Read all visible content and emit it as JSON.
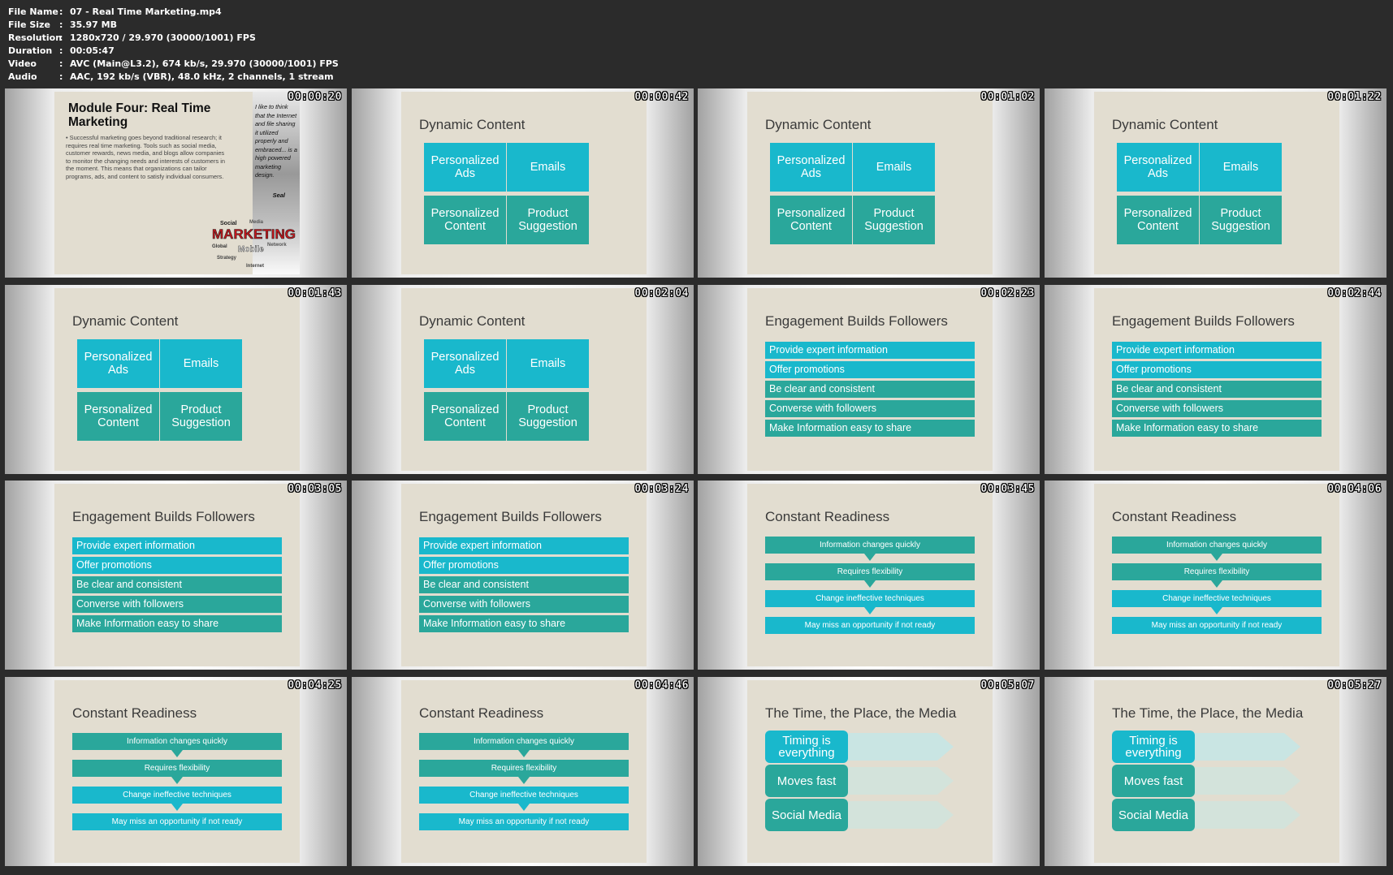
{
  "file_info": [
    {
      "key": "File Name",
      "value": "07 - Real Time Marketing.mp4"
    },
    {
      "key": "File Size",
      "value": "35.97 MB"
    },
    {
      "key": "Resolution",
      "value": "1280x720 / 29.970 (30000/1001) FPS"
    },
    {
      "key": "Duration",
      "value": "00:05:47"
    },
    {
      "key": "Video",
      "value": "AVC (Main@L3.2), 674 kb/s, 29.970 (30000/1001) FPS"
    },
    {
      "key": "Audio",
      "value": "AAC, 192 kb/s (VBR), 48.0 kHz, 2 channels, 1 stream"
    }
  ],
  "colors": {
    "teal_light": "#19b8cc",
    "teal_green": "#2aa79b",
    "slide_bg": "#e2ddd0"
  },
  "intro": {
    "title": "Module Four: Real Time Marketing",
    "body": "• Successful marketing goes beyond traditional research; it requires real time marketing. Tools such as social media, customer rewards, news media, and blogs allow companies to monitor the changing needs and interests of customers in the moment. This means that organizations can tailor programs, ads, and content to satisfy individual consumers.",
    "quote": "I like to think that the Internet and file sharing it utilized properly and embraced... is a high powered marketing design.",
    "quote_author": "Seal",
    "wordcloud": {
      "main": "MARKETING",
      "sub": "Mobile",
      "small": [
        "Social",
        "Internet",
        "Media",
        "Global",
        "Strategy",
        "Network"
      ]
    }
  },
  "dynamic": {
    "title": "Dynamic Content",
    "tiles": [
      "Personalized Ads",
      "Emails",
      "Personalized Content",
      "Product Suggestion"
    ]
  },
  "engagement": {
    "title": "Engagement Builds Followers",
    "items": [
      "Provide expert information",
      "Offer promotions",
      "Be clear and consistent",
      "Converse with followers",
      "Make Information easy to share"
    ]
  },
  "readiness": {
    "title": "Constant Readiness",
    "items": [
      "Information changes quickly",
      "Requires flexibility",
      "Change ineffective techniques",
      "May miss an opportunity if not ready"
    ]
  },
  "timeplace": {
    "title": "The Time, the Place, the Media",
    "items": [
      "Timing is everything",
      "Moves fast",
      "Social Media"
    ]
  },
  "thumbnails": [
    {
      "time": "00:00:20",
      "slide": "intro"
    },
    {
      "time": "00:00:42",
      "slide": "dynamic"
    },
    {
      "time": "00:01:02",
      "slide": "dynamic"
    },
    {
      "time": "00:01:22",
      "slide": "dynamic"
    },
    {
      "time": "00:01:43",
      "slide": "dynamic"
    },
    {
      "time": "00:02:04",
      "slide": "dynamic"
    },
    {
      "time": "00:02:23",
      "slide": "engagement"
    },
    {
      "time": "00:02:44",
      "slide": "engagement"
    },
    {
      "time": "00:03:05",
      "slide": "engagement"
    },
    {
      "time": "00:03:24",
      "slide": "engagement"
    },
    {
      "time": "00:03:45",
      "slide": "readiness"
    },
    {
      "time": "00:04:06",
      "slide": "readiness"
    },
    {
      "time": "00:04:25",
      "slide": "readiness"
    },
    {
      "time": "00:04:46",
      "slide": "readiness"
    },
    {
      "time": "00:05:07",
      "slide": "timeplace"
    },
    {
      "time": "00:05:27",
      "slide": "timeplace"
    }
  ]
}
